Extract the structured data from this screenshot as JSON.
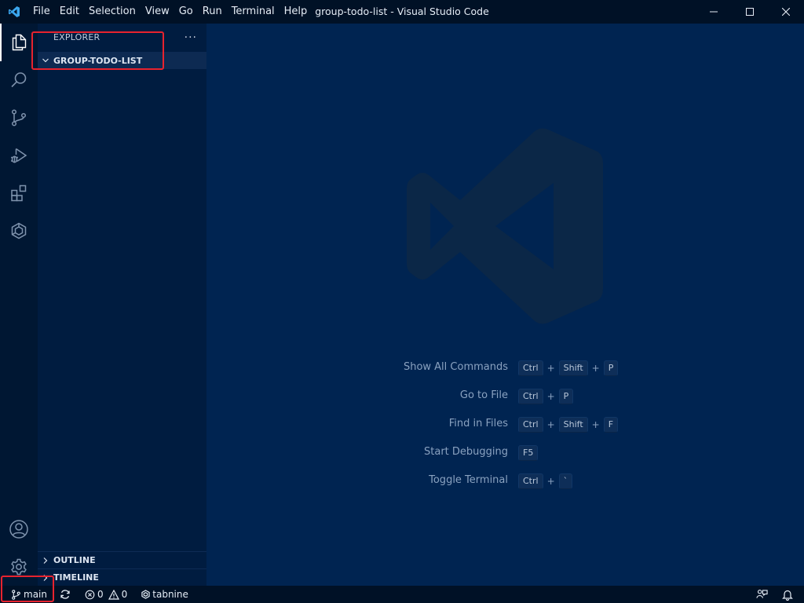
{
  "titlebar": {
    "window_title": "group-todo-list - Visual Studio Code",
    "menu": [
      "File",
      "Edit",
      "Selection",
      "View",
      "Go",
      "Run",
      "Terminal",
      "Help"
    ]
  },
  "activitybar": {
    "items": [
      "explorer-icon",
      "search-icon",
      "source-control-icon",
      "run-debug-icon",
      "extensions-icon",
      "tabnine-icon"
    ],
    "bottom_items": [
      "accounts-icon",
      "manage-gear-icon"
    ]
  },
  "sidebar": {
    "title": "EXPLORER",
    "more": "···",
    "folder": "GROUP-TODO-LIST",
    "outline": "OUTLINE",
    "timeline": "TIMELINE"
  },
  "editor": {
    "shortcuts": [
      {
        "label": "Show All Commands",
        "keys": [
          "Ctrl",
          "Shift",
          "P"
        ]
      },
      {
        "label": "Go to File",
        "keys": [
          "Ctrl",
          "P"
        ]
      },
      {
        "label": "Find in Files",
        "keys": [
          "Ctrl",
          "Shift",
          "F"
        ]
      },
      {
        "label": "Start Debugging",
        "keys": [
          "F5"
        ]
      },
      {
        "label": "Toggle Terminal",
        "keys": [
          "Ctrl",
          "`"
        ]
      }
    ]
  },
  "statusbar": {
    "branch": "main",
    "errors": "0",
    "warnings": "0",
    "tabnine": "tabnine"
  },
  "colors": {
    "accent": "#007acc",
    "background": "#002451",
    "highlight": "#e8232e"
  }
}
